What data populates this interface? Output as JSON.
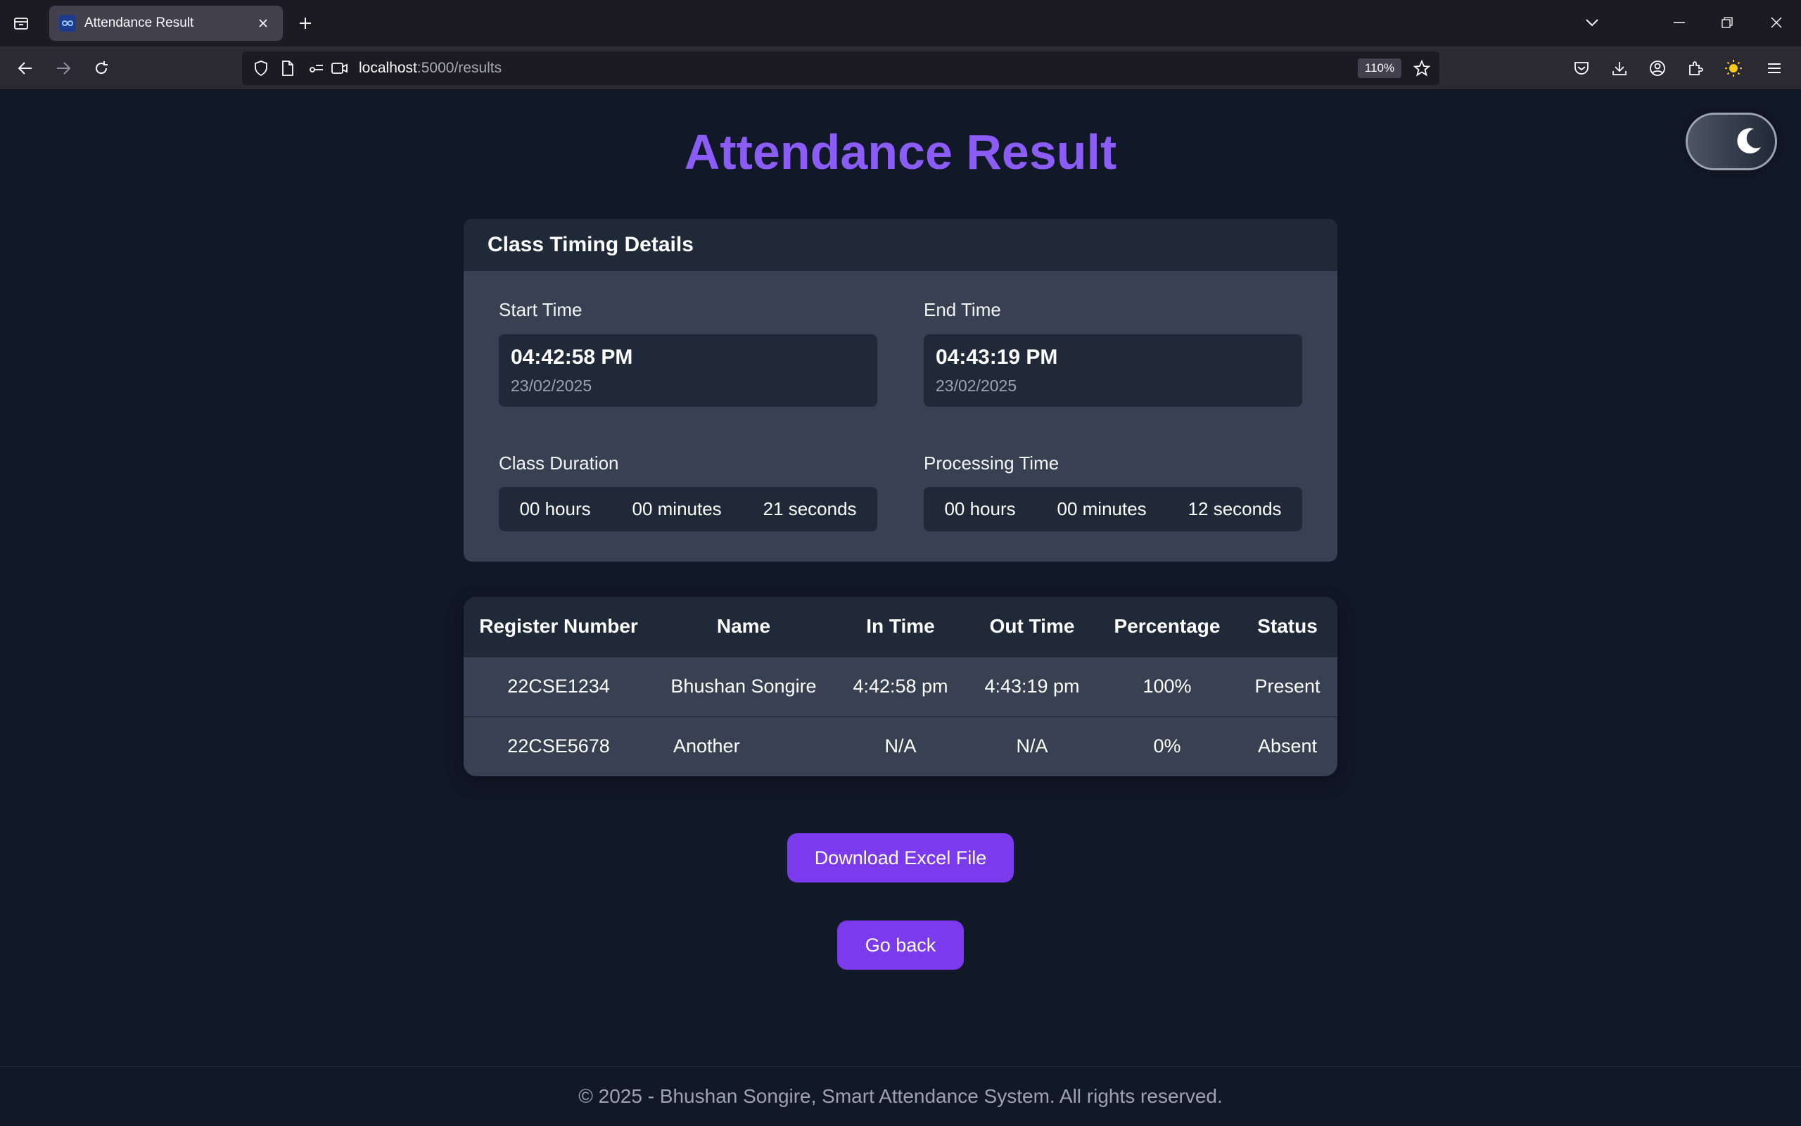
{
  "browser": {
    "tab_title": "Attendance Result",
    "url_host": "localhost",
    "url_path": ":5000/results",
    "zoom": "110%"
  },
  "page": {
    "title": "Attendance Result"
  },
  "timing": {
    "header": "Class Timing Details",
    "start": {
      "label": "Start Time",
      "time": "04:42:58 PM",
      "date": "23/02/2025"
    },
    "end": {
      "label": "End Time",
      "time": "04:43:19 PM",
      "date": "23/02/2025"
    },
    "duration": {
      "label": "Class Duration",
      "hours": "00 hours",
      "minutes": "00 minutes",
      "seconds": "21 seconds"
    },
    "processing": {
      "label": "Processing Time",
      "hours": "00 hours",
      "minutes": "00 minutes",
      "seconds": "12 seconds"
    }
  },
  "table": {
    "columns": [
      "Register Number",
      "Name",
      "In Time",
      "Out Time",
      "Percentage",
      "Status"
    ],
    "rows": [
      [
        "22CSE1234",
        "Bhushan Songire",
        "4:42:58 pm",
        "4:43:19 pm",
        "100%",
        "Present"
      ],
      [
        "22CSE5678",
        "Another",
        "N/A",
        "N/A",
        "0%",
        "Absent"
      ]
    ]
  },
  "actions": {
    "download": "Download Excel File",
    "back": "Go back"
  },
  "footer": {
    "text": "© 2025 - Bhushan Songire, Smart Attendance System. All rights reserved."
  },
  "colors": {
    "accent": "#7c3aed",
    "title": "#8b5cf6",
    "background": "#111827"
  }
}
